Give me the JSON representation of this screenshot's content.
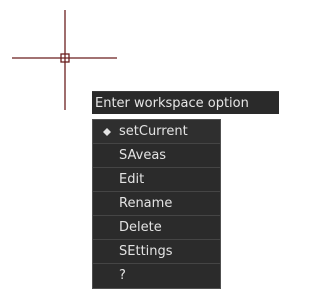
{
  "command_prompt": {
    "text": "Enter workspace option"
  },
  "options_menu": {
    "items": [
      {
        "label": "setCurrent",
        "selected": true
      },
      {
        "label": "SAveas",
        "selected": false
      },
      {
        "label": "Edit",
        "selected": false
      },
      {
        "label": "Rename",
        "selected": false
      },
      {
        "label": "Delete",
        "selected": false
      },
      {
        "label": "SEttings",
        "selected": false
      },
      {
        "label": "?",
        "selected": false
      }
    ]
  },
  "cursor": {
    "icon": "crosshair-cursor-icon",
    "color": "#6b1f1f"
  },
  "colors": {
    "drawing_background": "#ffffff",
    "menu_background": "#2b2b2b",
    "menu_text": "#e3e3e3"
  }
}
